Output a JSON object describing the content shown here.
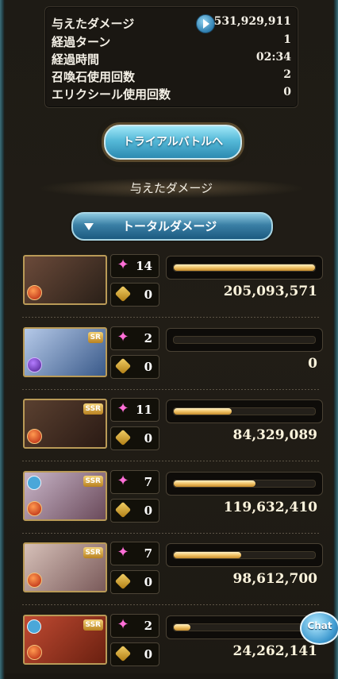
{
  "stats": {
    "rows": [
      {
        "label": "与えたダメージ",
        "value": "531,929,911"
      },
      {
        "label": "経過ターン",
        "value": "1"
      },
      {
        "label": "経過時間",
        "value": "02:34"
      },
      {
        "label": "召喚石使用回数",
        "value": "2"
      },
      {
        "label": "エリクシール使用回数",
        "value": "0"
      }
    ]
  },
  "trial_button": {
    "label": "トライアルバトルへ"
  },
  "section_title": "与えたダメージ",
  "dropdown": {
    "selected": "トータルダメージ"
  },
  "colors": {
    "accent_blue": "#3a7fa5",
    "bar_gold": "#f1c46a",
    "panel": "#1a1712"
  },
  "characters": [
    {
      "hits": "14",
      "zero": "0",
      "damage": "205,093,571",
      "bar_fraction": 1.0,
      "rarity": "",
      "element": "fire-element-icon"
    },
    {
      "hits": "2",
      "zero": "0",
      "damage": "0",
      "bar_fraction": 0.0,
      "rarity": "SR",
      "element": "dark-element-icon"
    },
    {
      "hits": "11",
      "zero": "0",
      "damage": "84,329,089",
      "bar_fraction": 0.41,
      "rarity": "SSR",
      "element": "fire-element-icon"
    },
    {
      "hits": "7",
      "zero": "0",
      "damage": "119,632,410",
      "bar_fraction": 0.58,
      "rarity": "SSR",
      "element": "fire-element-icon"
    },
    {
      "hits": "7",
      "zero": "0",
      "damage": "98,612,700",
      "bar_fraction": 0.48,
      "rarity": "SSR",
      "element": "fire-element-icon"
    },
    {
      "hits": "2",
      "zero": "0",
      "damage": "24,262,141",
      "bar_fraction": 0.12,
      "rarity": "SSR",
      "element": "fire-element-icon"
    }
  ],
  "chat": {
    "label": "Chat"
  }
}
